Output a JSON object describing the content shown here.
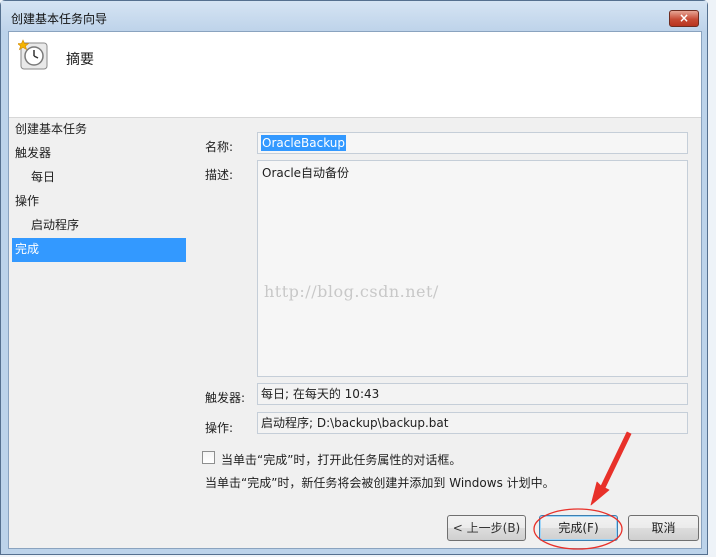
{
  "window": {
    "title": "创建基本任务向导",
    "close_icon": "×"
  },
  "header": {
    "title": "摘要"
  },
  "nav": {
    "items": [
      {
        "label": "创建基本任务"
      },
      {
        "label": "触发器"
      },
      {
        "label": "每日"
      },
      {
        "label": "操作"
      },
      {
        "label": "启动程序"
      },
      {
        "label": "完成"
      }
    ]
  },
  "form": {
    "name_label": "名称:",
    "name_value": "OracleBackup",
    "desc_label": "描述:",
    "desc_value": "Oracle自动备份",
    "watermark": "http://blog.csdn.net/",
    "trigger_label": "触发器:",
    "trigger_value": "每日; 在每天的 10:43",
    "action_label": "操作:",
    "action_value": "启动程序; D:\\backup\\backup.bat",
    "checkbox_label": "当单击“完成”时，打开此任务属性的对话框。",
    "note": "当单击“完成”时，新任务将会被创建并添加到 Windows 计划中。"
  },
  "buttons": {
    "back": "< 上一步(B)",
    "finish": "完成(F)",
    "cancel": "取消"
  },
  "colors": {
    "selection": "#3399ff",
    "annotation": "#e8312a"
  }
}
